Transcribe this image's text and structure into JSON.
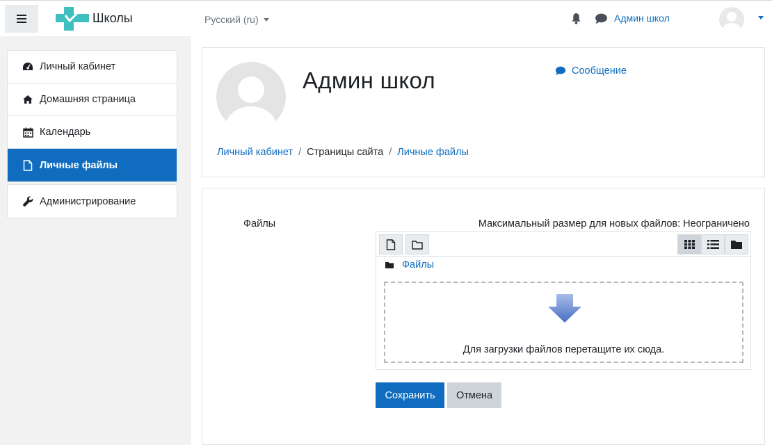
{
  "navbar": {
    "site_name": "Школы",
    "language": "Русский ‎(ru)‎",
    "username": "Админ школ"
  },
  "sidebar": {
    "items": [
      {
        "label": "Личный кабинет",
        "icon": "dashboard-icon"
      },
      {
        "label": "Домашняя страница",
        "icon": "home-icon"
      },
      {
        "label": "Календарь",
        "icon": "calendar-icon"
      },
      {
        "label": "Личные файлы",
        "icon": "file-icon",
        "active": true
      }
    ],
    "admin_item": {
      "label": "Администрирование",
      "icon": "wrench-icon"
    }
  },
  "header": {
    "title": "Админ школ",
    "message_link": "Сообщение",
    "breadcrumb": [
      "Личный кабинет",
      "Страницы сайта",
      "Личные файлы"
    ]
  },
  "filemanager": {
    "field_label": "Файлы",
    "max_size": "Максимальный размер для новых файлов: Неограничено",
    "current_folder": "Файлы",
    "drop_text": "Для загрузки файлов перетащите их сюда."
  },
  "actions": {
    "save": "Сохранить",
    "cancel": "Отмена"
  },
  "colors": {
    "accent": "#0f6cbf",
    "secondary_button": "#ced4da",
    "logo": "#3fbfbf"
  }
}
